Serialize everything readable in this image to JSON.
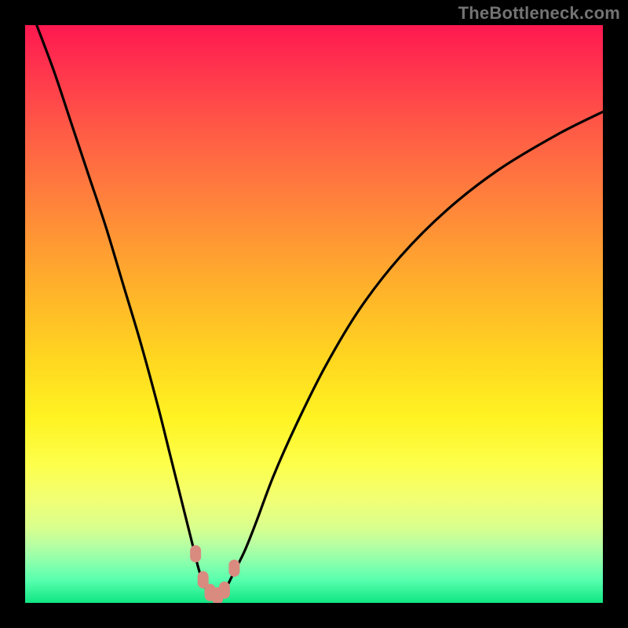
{
  "watermark": "TheBottleneck.com",
  "chart_data": {
    "type": "line",
    "title": "",
    "xlabel": "",
    "ylabel": "",
    "xlim": [
      0,
      100
    ],
    "ylim": [
      0,
      100
    ],
    "curve": {
      "name": "bottleneck-percent",
      "x": [
        2,
        5,
        8,
        11,
        14,
        17,
        20,
        23,
        25,
        27,
        29,
        30,
        31,
        32,
        33,
        34,
        35,
        36,
        38,
        40,
        43,
        47,
        52,
        58,
        65,
        73,
        82,
        92,
        100
      ],
      "y": [
        100,
        92,
        83,
        74,
        65,
        55,
        45,
        34,
        26,
        18,
        10,
        6,
        3,
        1.5,
        1,
        1.5,
        3,
        5,
        9,
        14,
        22,
        31,
        41,
        51,
        60,
        68,
        75,
        81,
        85
      ]
    },
    "markers": {
      "name": "highlight-points",
      "x": [
        29.5,
        30.8,
        32.0,
        33.3,
        34.5,
        36.2
      ],
      "y": [
        8.5,
        4.0,
        1.8,
        1.2,
        2.2,
        6.0
      ]
    },
    "gradient_stops": [
      {
        "pos": 0.0,
        "color": "#ff1850"
      },
      {
        "pos": 0.5,
        "color": "#ffc224"
      },
      {
        "pos": 0.78,
        "color": "#fcff50"
      },
      {
        "pos": 1.0,
        "color": "#10e683"
      }
    ]
  }
}
